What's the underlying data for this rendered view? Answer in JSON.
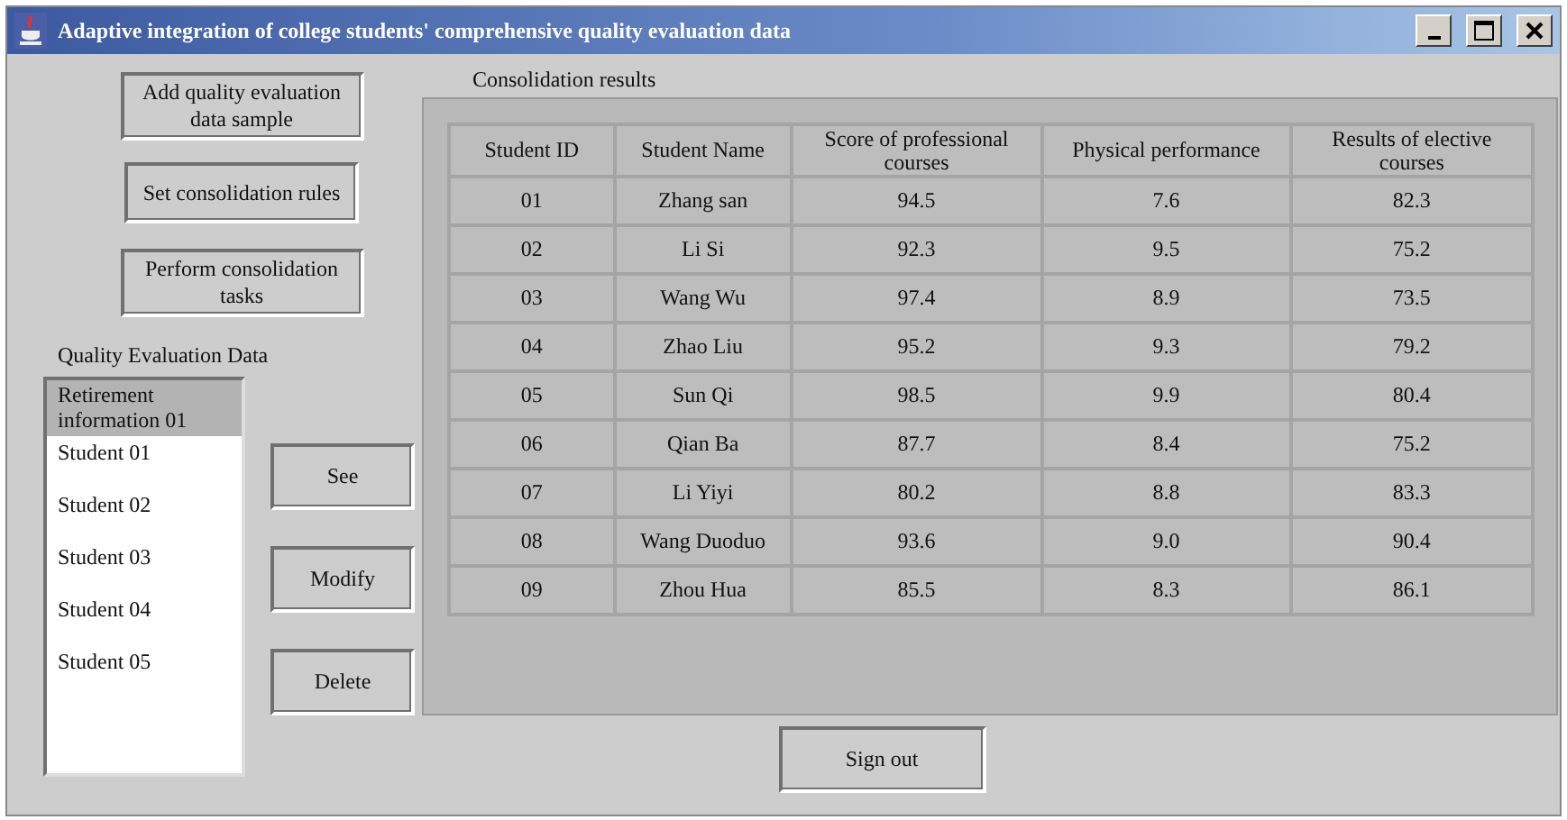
{
  "window": {
    "title": "Adaptive integration of college students' comprehensive quality evaluation data"
  },
  "actions": [
    "Add quality evaluation data sample",
    "Set consolidation rules",
    "Perform consolidation tasks"
  ],
  "data_list": {
    "label": "Quality Evaluation Data",
    "items": [
      {
        "text": "Retirement information 01",
        "selected": true
      },
      {
        "text": "Student 01",
        "selected": false
      },
      {
        "text": "Student 02",
        "selected": false
      },
      {
        "text": "Student 03",
        "selected": false
      },
      {
        "text": "Student 04",
        "selected": false
      },
      {
        "text": "Student 05",
        "selected": false
      }
    ]
  },
  "item_buttons": [
    "See",
    "Modify",
    "Delete"
  ],
  "results": {
    "label": "Consolidation results",
    "columns": [
      "Student ID",
      "Student Name",
      "Score of professional courses",
      "Physical performance",
      "Results of elective courses"
    ],
    "rows": [
      [
        "01",
        "Zhang san",
        "94.5",
        "7.6",
        "82.3"
      ],
      [
        "02",
        "Li Si",
        "92.3",
        "9.5",
        "75.2"
      ],
      [
        "03",
        "Wang Wu",
        "97.4",
        "8.9",
        "73.5"
      ],
      [
        "04",
        "Zhao Liu",
        "95.2",
        "9.3",
        "79.2"
      ],
      [
        "05",
        "Sun Qi",
        "98.5",
        "9.9",
        "80.4"
      ],
      [
        "06",
        "Qian Ba",
        "87.7",
        "8.4",
        "75.2"
      ],
      [
        "07",
        "Li Yiyi",
        "80.2",
        "8.8",
        "83.3"
      ],
      [
        "08",
        "Wang Duoduo",
        "93.6",
        "9.0",
        "90.4"
      ],
      [
        "09",
        "Zhou Hua",
        "85.5",
        "8.3",
        "86.1"
      ]
    ]
  },
  "footer_button": "Sign out"
}
